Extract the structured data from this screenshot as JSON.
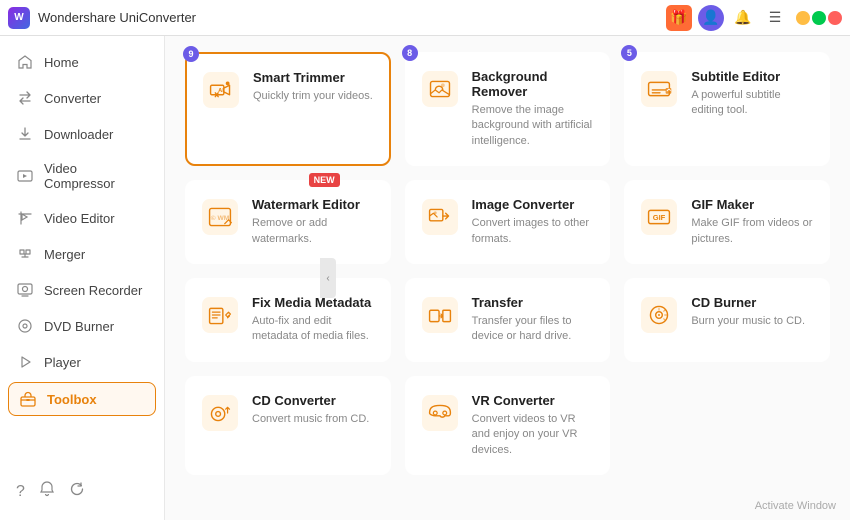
{
  "titleBar": {
    "appName": "Wondershare UniConverter",
    "icons": {
      "gift": "🎁",
      "user": "👤",
      "bell": "🔔",
      "menu": "☰",
      "minimize": "—",
      "maximize": "□",
      "close": "✕"
    }
  },
  "sidebar": {
    "items": [
      {
        "id": "home",
        "label": "Home",
        "icon": "⊞"
      },
      {
        "id": "converter",
        "label": "Converter",
        "icon": "⇄"
      },
      {
        "id": "downloader",
        "label": "Downloader",
        "icon": "↓"
      },
      {
        "id": "video-compressor",
        "label": "Video Compressor",
        "icon": "⊡"
      },
      {
        "id": "video-editor",
        "label": "Video Editor",
        "icon": "✂"
      },
      {
        "id": "merger",
        "label": "Merger",
        "icon": "⊕"
      },
      {
        "id": "screen-recorder",
        "label": "Screen Recorder",
        "icon": "⬜"
      },
      {
        "id": "dvd-burner",
        "label": "DVD Burner",
        "icon": "💿"
      },
      {
        "id": "player",
        "label": "Player",
        "icon": "▶"
      },
      {
        "id": "toolbox",
        "label": "Toolbox",
        "icon": "⊞",
        "active": true
      }
    ],
    "bottomIcons": [
      "?",
      "🔔",
      "↻"
    ]
  },
  "content": {
    "activateText": "Activate Window",
    "tools": [
      {
        "id": "smart-trimmer",
        "title": "Smart Trimmer",
        "desc": "Quickly trim your videos.",
        "badge": "9",
        "highlighted": true,
        "iconColor": "#e8820c"
      },
      {
        "id": "background-remover",
        "title": "Background Remover",
        "desc": "Remove the image background with artificial intelligence.",
        "badge": "8",
        "highlighted": false,
        "iconColor": "#e8820c"
      },
      {
        "id": "subtitle-editor",
        "title": "Subtitle Editor",
        "desc": "A powerful subtitle editing tool.",
        "badge": "5",
        "highlighted": false,
        "iconColor": "#e8820c"
      },
      {
        "id": "watermark-editor",
        "title": "Watermark Editor",
        "desc": "Remove or add watermarks.",
        "badge": null,
        "badgeNew": "NEW",
        "highlighted": false,
        "iconColor": "#e8820c"
      },
      {
        "id": "image-converter",
        "title": "Image Converter",
        "desc": "Convert images to other formats.",
        "badge": null,
        "highlighted": false,
        "iconColor": "#e8820c"
      },
      {
        "id": "gif-maker",
        "title": "GIF Maker",
        "desc": "Make GIF from videos or pictures.",
        "badge": null,
        "highlighted": false,
        "iconColor": "#e8820c"
      },
      {
        "id": "fix-media-metadata",
        "title": "Fix Media Metadata",
        "desc": "Auto-fix and edit metadata of media files.",
        "badge": null,
        "highlighted": false,
        "iconColor": "#e8820c"
      },
      {
        "id": "transfer",
        "title": "Transfer",
        "desc": "Transfer your files to device or hard drive.",
        "badge": null,
        "highlighted": false,
        "iconColor": "#e8820c"
      },
      {
        "id": "cd-burner",
        "title": "CD Burner",
        "desc": "Burn your music to CD.",
        "badge": null,
        "highlighted": false,
        "iconColor": "#e8820c"
      },
      {
        "id": "cd-converter",
        "title": "CD Converter",
        "desc": "Convert music from CD.",
        "badge": null,
        "highlighted": false,
        "iconColor": "#e8820c"
      },
      {
        "id": "vr-converter",
        "title": "VR Converter",
        "desc": "Convert videos to VR and enjoy on your VR devices.",
        "badge": null,
        "highlighted": false,
        "iconColor": "#e8820c"
      }
    ]
  }
}
